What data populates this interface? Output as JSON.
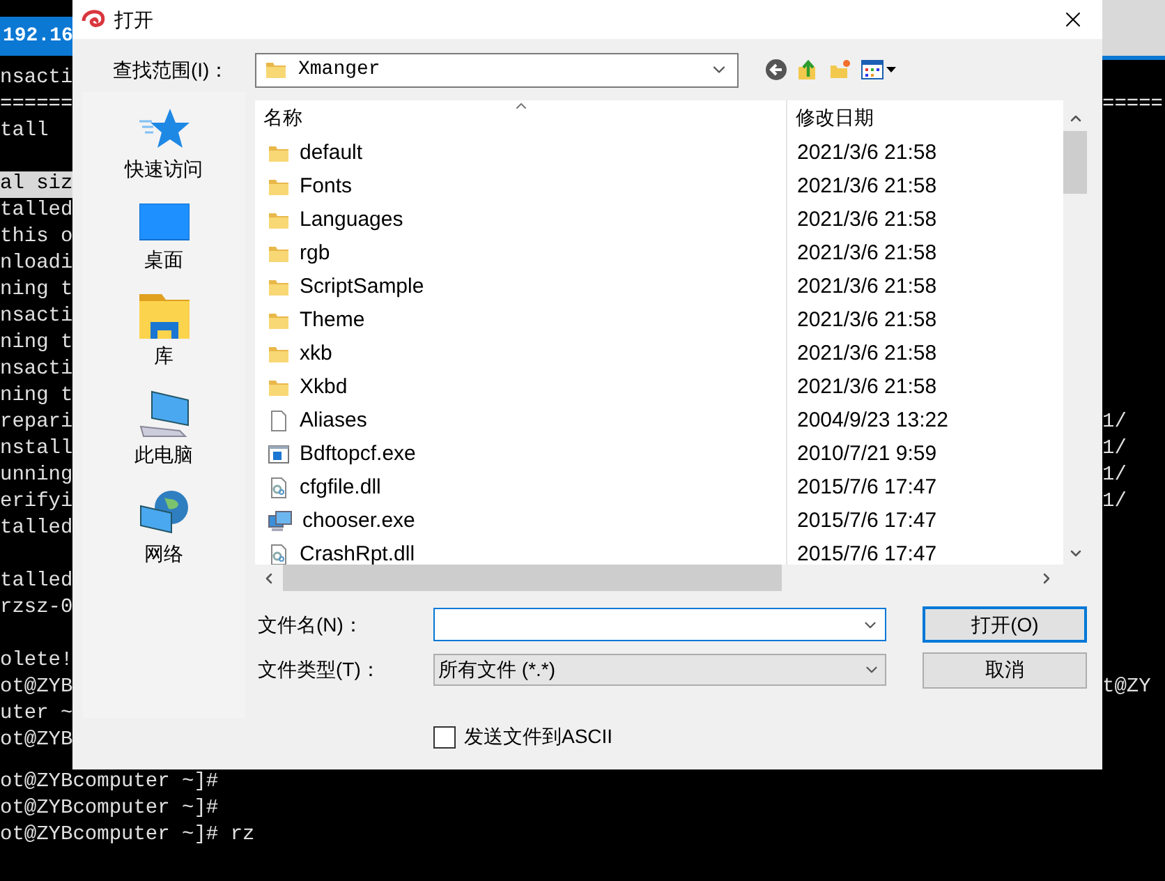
{
  "terminal": {
    "title": "192.16",
    "rows": [
      {
        "kind": "text",
        "left": "nsacti"
      },
      {
        "kind": "text",
        "left": "======",
        "right": "====="
      },
      {
        "kind": "text",
        "left": "tall"
      },
      {
        "kind": "blank"
      },
      {
        "kind": "text",
        "left": "al siz",
        "highlighted": true
      },
      {
        "kind": "text",
        "left": "talled"
      },
      {
        "kind": "text",
        "left": "this o"
      },
      {
        "kind": "text",
        "left": "nloadi"
      },
      {
        "kind": "text",
        "left": "ning t"
      },
      {
        "kind": "text",
        "left": "nsacti"
      },
      {
        "kind": "text",
        "left": "ning t"
      },
      {
        "kind": "text",
        "left": "nsacti"
      },
      {
        "kind": "text",
        "left": "ning t"
      },
      {
        "kind": "text",
        "left": "repari",
        "right": "1/"
      },
      {
        "kind": "text",
        "left": "nstall",
        "right": "1/"
      },
      {
        "kind": "text",
        "left": "unning",
        "right": "1/"
      },
      {
        "kind": "text",
        "left": "erifyi",
        "right": "1/"
      },
      {
        "kind": "text",
        "left": "talled"
      },
      {
        "kind": "blank"
      },
      {
        "kind": "text",
        "left": "talled"
      },
      {
        "kind": "text",
        "left": "rzsz-0"
      },
      {
        "kind": "blank"
      },
      {
        "kind": "text",
        "left": "olete!"
      },
      {
        "kind": "text",
        "left": "ot@ZYB",
        "right": "t@ZY"
      },
      {
        "kind": "text",
        "left": "uter ~"
      },
      {
        "kind": "text",
        "left": "ot@ZYB"
      }
    ],
    "bottom_lines": [
      "ot@ZYBcomputer ~]#",
      "ot@ZYBcomputer ~]#",
      "ot@ZYBcomputer ~]# rz"
    ]
  },
  "dialog": {
    "title": "打开",
    "look_in": {
      "label": "查找范围(I)：",
      "value": "Xmanger"
    },
    "places": [
      {
        "label": "快速访问",
        "kind": "quick"
      },
      {
        "label": "桌面",
        "kind": "desktop"
      },
      {
        "label": "库",
        "kind": "library"
      },
      {
        "label": "此电脑",
        "kind": "computer"
      },
      {
        "label": "网络",
        "kind": "network"
      }
    ],
    "columns": [
      {
        "label": "名称",
        "sorted": true
      },
      {
        "label": "修改日期",
        "sorted": false
      }
    ],
    "files": [
      {
        "name": "default",
        "modified": "2021/3/6 21:58",
        "kind": "folder"
      },
      {
        "name": "Fonts",
        "modified": "2021/3/6 21:58",
        "kind": "folder"
      },
      {
        "name": "Languages",
        "modified": "2021/3/6 21:58",
        "kind": "folder"
      },
      {
        "name": "rgb",
        "modified": "2021/3/6 21:58",
        "kind": "folder"
      },
      {
        "name": "ScriptSample",
        "modified": "2021/3/6 21:58",
        "kind": "folder"
      },
      {
        "name": "Theme",
        "modified": "2021/3/6 21:58",
        "kind": "folder"
      },
      {
        "name": "xkb",
        "modified": "2021/3/6 21:58",
        "kind": "folder"
      },
      {
        "name": "Xkbd",
        "modified": "2021/3/6 21:58",
        "kind": "folder"
      },
      {
        "name": "Aliases",
        "modified": "2004/9/23 13:22",
        "kind": "file"
      },
      {
        "name": "Bdftopcf.exe",
        "modified": "2010/7/21 9:59",
        "kind": "exe"
      },
      {
        "name": "cfgfile.dll",
        "modified": "2015/7/6 17:47",
        "kind": "dll"
      },
      {
        "name": "chooser.exe",
        "modified": "2015/7/6 17:47",
        "kind": "app"
      },
      {
        "name": "CrashRpt.dll",
        "modified": "2015/7/6 17:47",
        "kind": "dll"
      }
    ],
    "file_name": {
      "label": "文件名(N)："
    },
    "file_type": {
      "label": "文件类型(T)：",
      "value": "所有文件 (*.*)"
    },
    "buttons": [
      {
        "label": "打开(O)",
        "default": true
      },
      {
        "label": "取消",
        "default": false
      }
    ],
    "send_ascii": {
      "label": "发送文件到ASCII",
      "checked": false
    }
  }
}
